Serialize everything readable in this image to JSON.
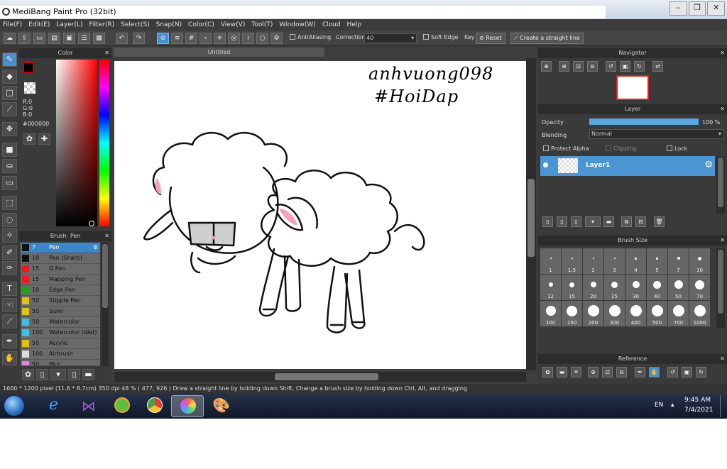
{
  "window": {
    "title": "MediBang Paint Pro (32bit)",
    "minimize": "0",
    "restore": "1",
    "close": "r"
  },
  "menu": [
    "File(F)",
    "Edit(E)",
    "Layer(L)",
    "Filter(R)",
    "Select(S)",
    "Snap(N)",
    "Color(C)",
    "View(V)",
    "Tool(T)",
    "Window(W)",
    "Cloud",
    "Help"
  ],
  "toolbar": {
    "antialiasing": "AntiAliasing",
    "correction_label": "Correction",
    "correction_value": "40",
    "soft_edge": "Soft Edge",
    "key": "Key",
    "reset": "Reset",
    "straight_line": "Create a straight line"
  },
  "color_panel": {
    "title": "Color",
    "r": "R:0",
    "g": "G:0",
    "b": "B:0",
    "hex": "#000000",
    "accent": "#cc0000"
  },
  "brush_panel": {
    "title": "Brush: Pen",
    "brushes": [
      {
        "size": "7",
        "name": "Pen",
        "color": "#111111"
      },
      {
        "size": "10",
        "name": "Pen (Sharp)",
        "color": "#111111"
      },
      {
        "size": "15",
        "name": "G Pen",
        "color": "#e02020"
      },
      {
        "size": "15",
        "name": "Mapping Pen",
        "color": "#e02020"
      },
      {
        "size": "10",
        "name": "Edge Pen",
        "color": "#20a020"
      },
      {
        "size": "50",
        "name": "Stipple Pen",
        "color": "#e0c020"
      },
      {
        "size": "50",
        "name": "Sumi",
        "color": "#e0c020"
      },
      {
        "size": "50",
        "name": "Watercolor",
        "color": "#40c0e0"
      },
      {
        "size": "100",
        "name": "Watercolor (Wet)",
        "color": "#40c0e0"
      },
      {
        "size": "50",
        "name": "Acrylic",
        "color": "#e0c020"
      },
      {
        "size": "100",
        "name": "Airbrush",
        "color": "#dddddd"
      },
      {
        "size": "50",
        "name": "Blur",
        "color": "#e080e0"
      }
    ]
  },
  "canvas": {
    "tab_title": "Untitled",
    "signature_line1": "anhvuong098",
    "signature_line2": "#HoiDap"
  },
  "navigator": {
    "title": "Navigator"
  },
  "layer_panel": {
    "title": "Layer",
    "opacity_label": "Opacity",
    "opacity_value": "100 %",
    "opacity": 1.0,
    "blending_label": "Blending",
    "blending_value": "Normal",
    "protect_alpha": "Protect Alpha",
    "clipping": "Clipping",
    "lock": "Lock",
    "layer_name": "Layer1"
  },
  "brush_size": {
    "title": "Brush Size",
    "sizes": [
      "1",
      "1.5",
      "2",
      "3",
      "4",
      "5",
      "7",
      "10",
      "12",
      "15",
      "20",
      "25",
      "30",
      "40",
      "50",
      "70",
      "100",
      "150",
      "200",
      "300",
      "400",
      "500",
      "700",
      "1000"
    ]
  },
  "reference": {
    "title": "Reference"
  },
  "status": {
    "text": "1600 * 1200 pixel   (11.6 * 8.7cm)   350 dpi   48 %   ( 477, 926 )   Draw a straight line by holding down Shift, Change a brush size by holding down Ctrl, Alt, and dragging"
  },
  "taskbar": {
    "lang": "EN",
    "time": "9:45 AM",
    "date": "7/4/2021"
  }
}
